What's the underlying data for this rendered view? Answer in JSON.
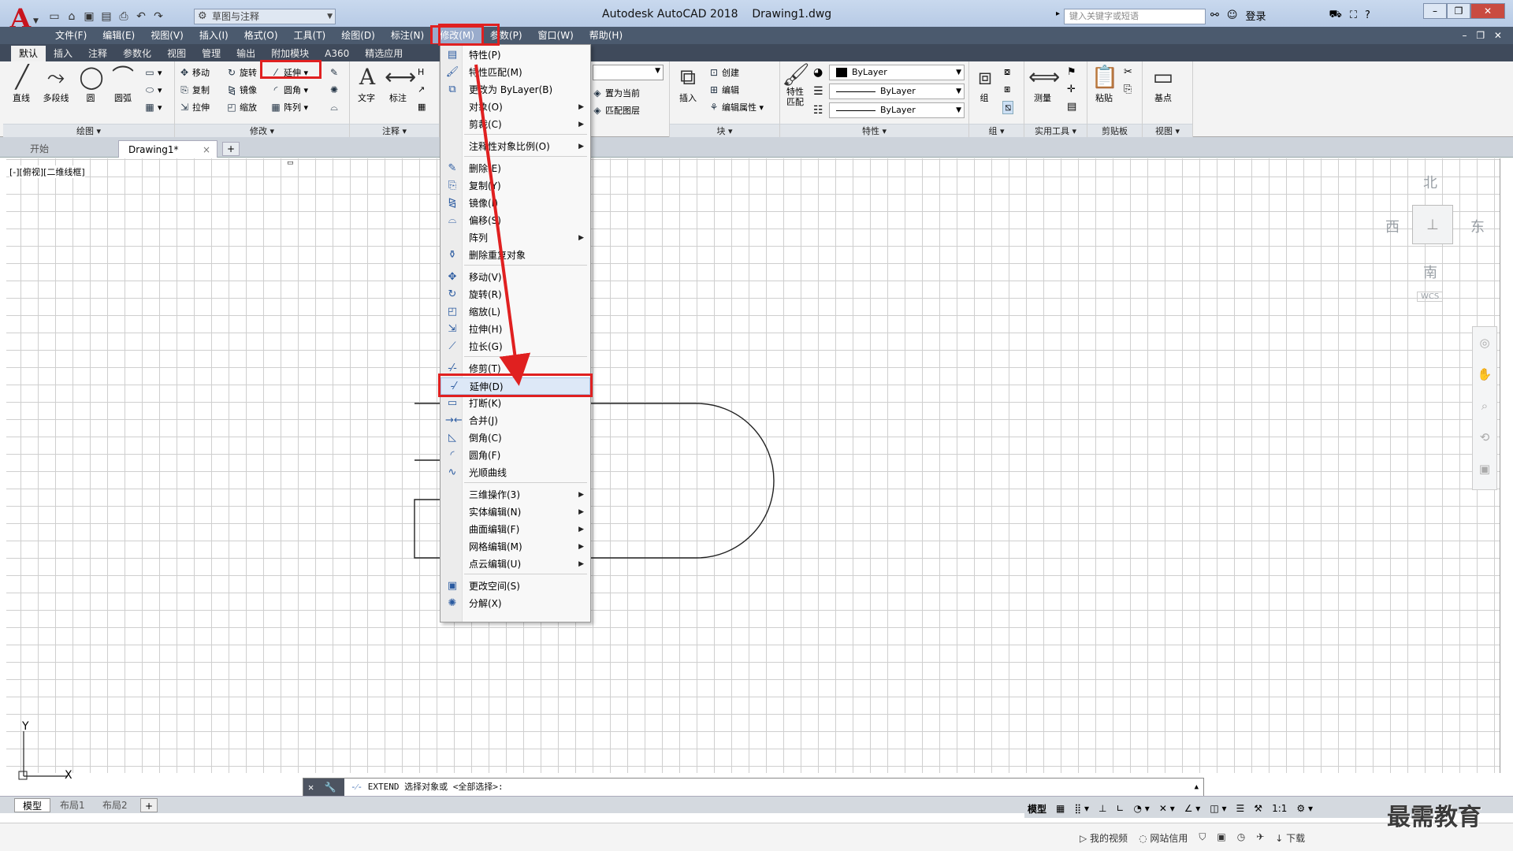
{
  "app": {
    "logo": "A",
    "title": "Autodesk AutoCAD 2018",
    "file": "Drawing1.dwg",
    "workspace": "草图与注释",
    "search_placeholder": "键入关键字或短语",
    "login": "登录",
    "help": "?"
  },
  "menus": [
    "文件(F)",
    "编辑(E)",
    "视图(V)",
    "插入(I)",
    "格式(O)",
    "工具(T)",
    "绘图(D)",
    "标注(N)",
    "修改(M)",
    "参数(P)",
    "窗口(W)",
    "帮助(H)"
  ],
  "active_menu": "修改(M)",
  "ribbon_tabs": [
    "默认",
    "插入",
    "注释",
    "参数化",
    "视图",
    "管理",
    "输出",
    "附加模块",
    "A360",
    "精选应用"
  ],
  "ribbon": {
    "draw": {
      "title": "绘图",
      "line": "直线",
      "polyline": "多段线",
      "circle": "圆",
      "arc": "圆弧"
    },
    "modify": {
      "title": "修改",
      "move": "移动",
      "rotate": "旋转",
      "extend": "延伸",
      "copy": "复制",
      "mirror": "镜像",
      "fillet": "圆角",
      "stretch": "拉伸",
      "scale": "缩放",
      "array": "阵列"
    },
    "annotation": {
      "title": "注释",
      "text": "文字",
      "dim": "标注"
    },
    "layers": {
      "set_current": "置为当前",
      "match_layer": "匹配图层"
    },
    "block": {
      "title": "块",
      "insert": "插入",
      "create": "创建",
      "edit": "编辑",
      "edit_attr": "编辑属性"
    },
    "properties": {
      "title": "特性",
      "match": "特性\n匹配",
      "color": "ByLayer",
      "linetype": "ByLayer",
      "lineweight": "ByLayer"
    },
    "groups": {
      "title": "组",
      "group": "组"
    },
    "utilities": {
      "title": "实用工具",
      "measure": "测量"
    },
    "clipboard": {
      "title": "剪贴板",
      "paste": "粘贴"
    },
    "view": {
      "title": "视图",
      "base": "基点"
    }
  },
  "doc_tabs": {
    "start": "开始",
    "drawing": "Drawing1*",
    "close": "×",
    "add": "+"
  },
  "viewport_label": "[-][俯视][二维线框]",
  "navcube": {
    "n": "北",
    "s": "南",
    "w": "西",
    "e": "东",
    "wcs": "WCS"
  },
  "ucs": {
    "x": "X",
    "y": "Y"
  },
  "dropdown_items": [
    {
      "label": "特性(P)",
      "icon": "properties-icon",
      "sep_before": false,
      "sub": false
    },
    {
      "label": "特性匹配(M)",
      "icon": "match-properties-icon",
      "sep_before": false,
      "sub": false
    },
    {
      "label": "更改为 ByLayer(B)",
      "icon": "bylayer-icon",
      "sep_before": false,
      "sub": false
    },
    {
      "label": "对象(O)",
      "icon": "",
      "sep_before": false,
      "sub": true
    },
    {
      "label": "剪裁(C)",
      "icon": "",
      "sep_before": false,
      "sub": true
    },
    {
      "label": "注释性对象比例(O)",
      "icon": "",
      "sep_before": true,
      "sub": true
    },
    {
      "label": "删除(E)",
      "icon": "erase-icon",
      "sep_before": true,
      "sub": false
    },
    {
      "label": "复制(Y)",
      "icon": "copy-icon",
      "sep_before": false,
      "sub": false
    },
    {
      "label": "镜像(I)",
      "icon": "mirror-icon",
      "sep_before": false,
      "sub": false
    },
    {
      "label": "偏移(S)",
      "icon": "offset-icon",
      "sep_before": false,
      "sub": false
    },
    {
      "label": "阵列",
      "icon": "",
      "sep_before": false,
      "sub": true
    },
    {
      "label": "删除重复对象",
      "icon": "overkill-icon",
      "sep_before": false,
      "sub": false
    },
    {
      "label": "移动(V)",
      "icon": "move-icon",
      "sep_before": true,
      "sub": false
    },
    {
      "label": "旋转(R)",
      "icon": "rotate-icon",
      "sep_before": false,
      "sub": false
    },
    {
      "label": "缩放(L)",
      "icon": "scale-icon",
      "sep_before": false,
      "sub": false
    },
    {
      "label": "拉伸(H)",
      "icon": "stretch-icon",
      "sep_before": false,
      "sub": false
    },
    {
      "label": "拉长(G)",
      "icon": "lengthen-icon",
      "sep_before": false,
      "sub": false
    },
    {
      "label": "修剪(T)",
      "icon": "trim-icon",
      "sep_before": true,
      "sub": false
    },
    {
      "label": "延伸(D)",
      "icon": "extend-icon",
      "sep_before": false,
      "sub": false
    },
    {
      "label": "打断(K)",
      "icon": "break-icon",
      "sep_before": false,
      "sub": false
    },
    {
      "label": "合并(J)",
      "icon": "join-icon",
      "sep_before": false,
      "sub": false
    },
    {
      "label": "倒角(C)",
      "icon": "chamfer-icon",
      "sep_before": false,
      "sub": false
    },
    {
      "label": "圆角(F)",
      "icon": "fillet-icon",
      "sep_before": false,
      "sub": false
    },
    {
      "label": "光顺曲线",
      "icon": "blend-icon",
      "sep_before": false,
      "sub": false
    },
    {
      "label": "三维操作(3)",
      "icon": "",
      "sep_before": true,
      "sub": true
    },
    {
      "label": "实体编辑(N)",
      "icon": "",
      "sep_before": false,
      "sub": true
    },
    {
      "label": "曲面编辑(F)",
      "icon": "",
      "sep_before": false,
      "sub": true
    },
    {
      "label": "网格编辑(M)",
      "icon": "",
      "sep_before": false,
      "sub": true
    },
    {
      "label": "点云编辑(U)",
      "icon": "",
      "sep_before": false,
      "sub": true
    },
    {
      "label": "更改空间(S)",
      "icon": "chspace-icon",
      "sep_before": true,
      "sub": false
    },
    {
      "label": "分解(X)",
      "icon": "explode-icon",
      "sep_before": false,
      "sub": false
    }
  ],
  "highlighted_item": "延伸(D)",
  "command_line": {
    "prompt": "EXTEND 选择对象或 <全部选择>:"
  },
  "layout_tabs": [
    "模型",
    "布局1",
    "布局2",
    "+"
  ],
  "status": {
    "model": "模型",
    "scale": "1:1"
  },
  "taskbar": [
    "我的视频",
    "网站信用",
    "下载"
  ],
  "watermark": "最需教育",
  "colors": {
    "highlight_box": "#e02020",
    "menubar": "#4b5a6e",
    "ribbon_tabs": "#3f4a5b",
    "logo": "#c8141e"
  }
}
